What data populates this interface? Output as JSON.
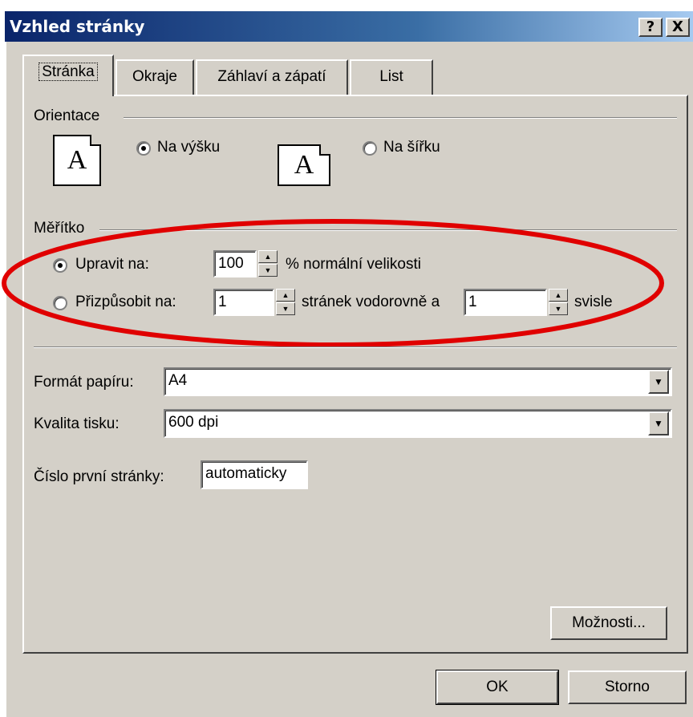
{
  "window": {
    "title": "Vzhled stránky",
    "help_button": "?",
    "close_button": "X"
  },
  "tabs": [
    {
      "label": "Stránka",
      "active": true
    },
    {
      "label": "Okraje",
      "active": false
    },
    {
      "label": "Záhlaví a zápatí",
      "active": false
    },
    {
      "label": "List",
      "active": false
    }
  ],
  "orientation": {
    "group_label": "Orientace",
    "portrait_label": "Na výšku",
    "landscape_label": "Na šířku",
    "portrait_selected": true,
    "icon_letter": "A"
  },
  "scale": {
    "group_label": "Měřítko",
    "adjust_label": "Upravit na:",
    "adjust_value": "100",
    "adjust_suffix": "% normální velikosti",
    "adjust_selected": true,
    "fit_label": "Přizpůsobit na:",
    "fit_wide_value": "1",
    "fit_wide_suffix": "stránek vodorovně a",
    "fit_tall_value": "1",
    "fit_tall_suffix": "svisle",
    "highlight_color": "#e00000"
  },
  "paper": {
    "format_label": "Formát papíru:",
    "format_value": "A4",
    "quality_label": "Kvalita tisku:",
    "quality_value": "600 dpi",
    "first_page_label": "Číslo první stránky:",
    "first_page_value": "automaticky"
  },
  "buttons": {
    "options": "Možnosti...",
    "ok": "OK",
    "cancel": "Storno"
  },
  "colors": {
    "dialog_bg": "#d4d0c8",
    "title_start": "#0a246a",
    "title_end": "#a6caf0"
  }
}
